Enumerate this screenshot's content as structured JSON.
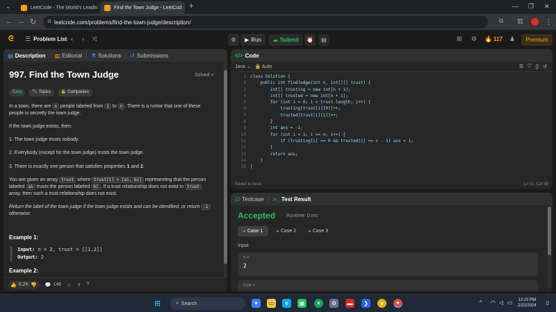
{
  "browser": {
    "tabs": [
      {
        "title": "LeetCode - The World's Leadin",
        "active": false
      },
      {
        "title": "Find the Town Judge - LeetCod",
        "active": true
      }
    ],
    "url": "leetcode.com/problems/find-the-town-judge/description/"
  },
  "header": {
    "problem_list": "Problem List",
    "run": "Run",
    "submit": "Submit",
    "streak": "117",
    "premium": "Premium"
  },
  "description": {
    "tabs": [
      "Description",
      "Editorial",
      "Solutions",
      "Submissions"
    ],
    "title": "997. Find the Town Judge",
    "solved": "Solved",
    "chips": [
      "Easy",
      "Topics",
      "Companies"
    ],
    "p1_a": "In a town, there are ",
    "p1_code1": "n",
    "p1_b": " people labeled from ",
    "p1_code2": "1",
    "p1_c": " to ",
    "p1_code3": "n",
    "p1_d": ". There is a rumor that one of these people is secretly the town judge.",
    "p2": "If the town judge exists, then:",
    "rule1": "1. The town judge trusts nobody.",
    "rule2": "2. Everybody (except for the town judge) trusts the town judge.",
    "rule3_a": "3. There is exactly one person that satisfies properties ",
    "rule3_b1": "1",
    "rule3_c": " and ",
    "rule3_b2": "2",
    "rule3_d": ".",
    "p3_a": "You are given an array ",
    "p3_code1": "trust",
    "p3_b": " where ",
    "p3_code2": "trust[i] = [ai, bi]",
    "p3_c": " representing that the person labeled ",
    "p3_code3": "ai",
    "p3_d": " trusts the person labeled ",
    "p3_code4": "bi",
    "p3_e": ". If a trust relationship does not exist in ",
    "p3_code5": "trust",
    "p3_f": " array, then such a trust relationship does not exist.",
    "p4": "Return the label of the town judge if the town judge exists and can be identified, or return ",
    "p4_code": "-1",
    "p4_end": " otherwise.",
    "example1_title": "Example 1:",
    "example1_input_label": "Input:",
    "example1_input": " n = 2, trust = [[1,2]]",
    "example1_output_label": "Output:",
    "example1_output": " 2",
    "example2_title": "Example 2:",
    "likes": "6.2K",
    "comments": "146"
  },
  "code": {
    "tab": "Code",
    "language": "Java",
    "mode": "Auto",
    "lines": [
      "class Solution {",
      "    public int findJudge(int n, int[][] trust) {",
      "        int[] trusting = new int[n + 1];",
      "        int[] trusted = new int[n + 1];",
      "        for (int i = 0; i < trust.length; i++) {",
      "            trusting[trust[i][0]]++;",
      "            trusted[trust[i][1]]++;",
      "        }",
      "        int ans = -1;",
      "        for (int i = 1; i <= n; i++) {",
      "            if (trusting[i] == 0 && trusted[i] == n - 1) ans = i;",
      "        }",
      "        return ans;",
      "    }",
      "}"
    ],
    "saved": "Saved to local",
    "cursor": "Ln 11, Col 58"
  },
  "result": {
    "tabs": [
      "Testcase",
      "Test Result"
    ],
    "status": "Accepted",
    "runtime": "Runtime: 0 ms",
    "cases": [
      "Case 1",
      "Case 2",
      "Case 3"
    ],
    "input_label": "Input",
    "n_label": "n =",
    "n_value": "2",
    "trust_label": "trust ="
  },
  "taskbar": {
    "search": "Search",
    "time": "12:23 PM",
    "date": "2/22/2024"
  },
  "colors": {
    "accent": "#ffa116",
    "accepted": "#2cbb5d",
    "easy": "#46c6c2"
  }
}
